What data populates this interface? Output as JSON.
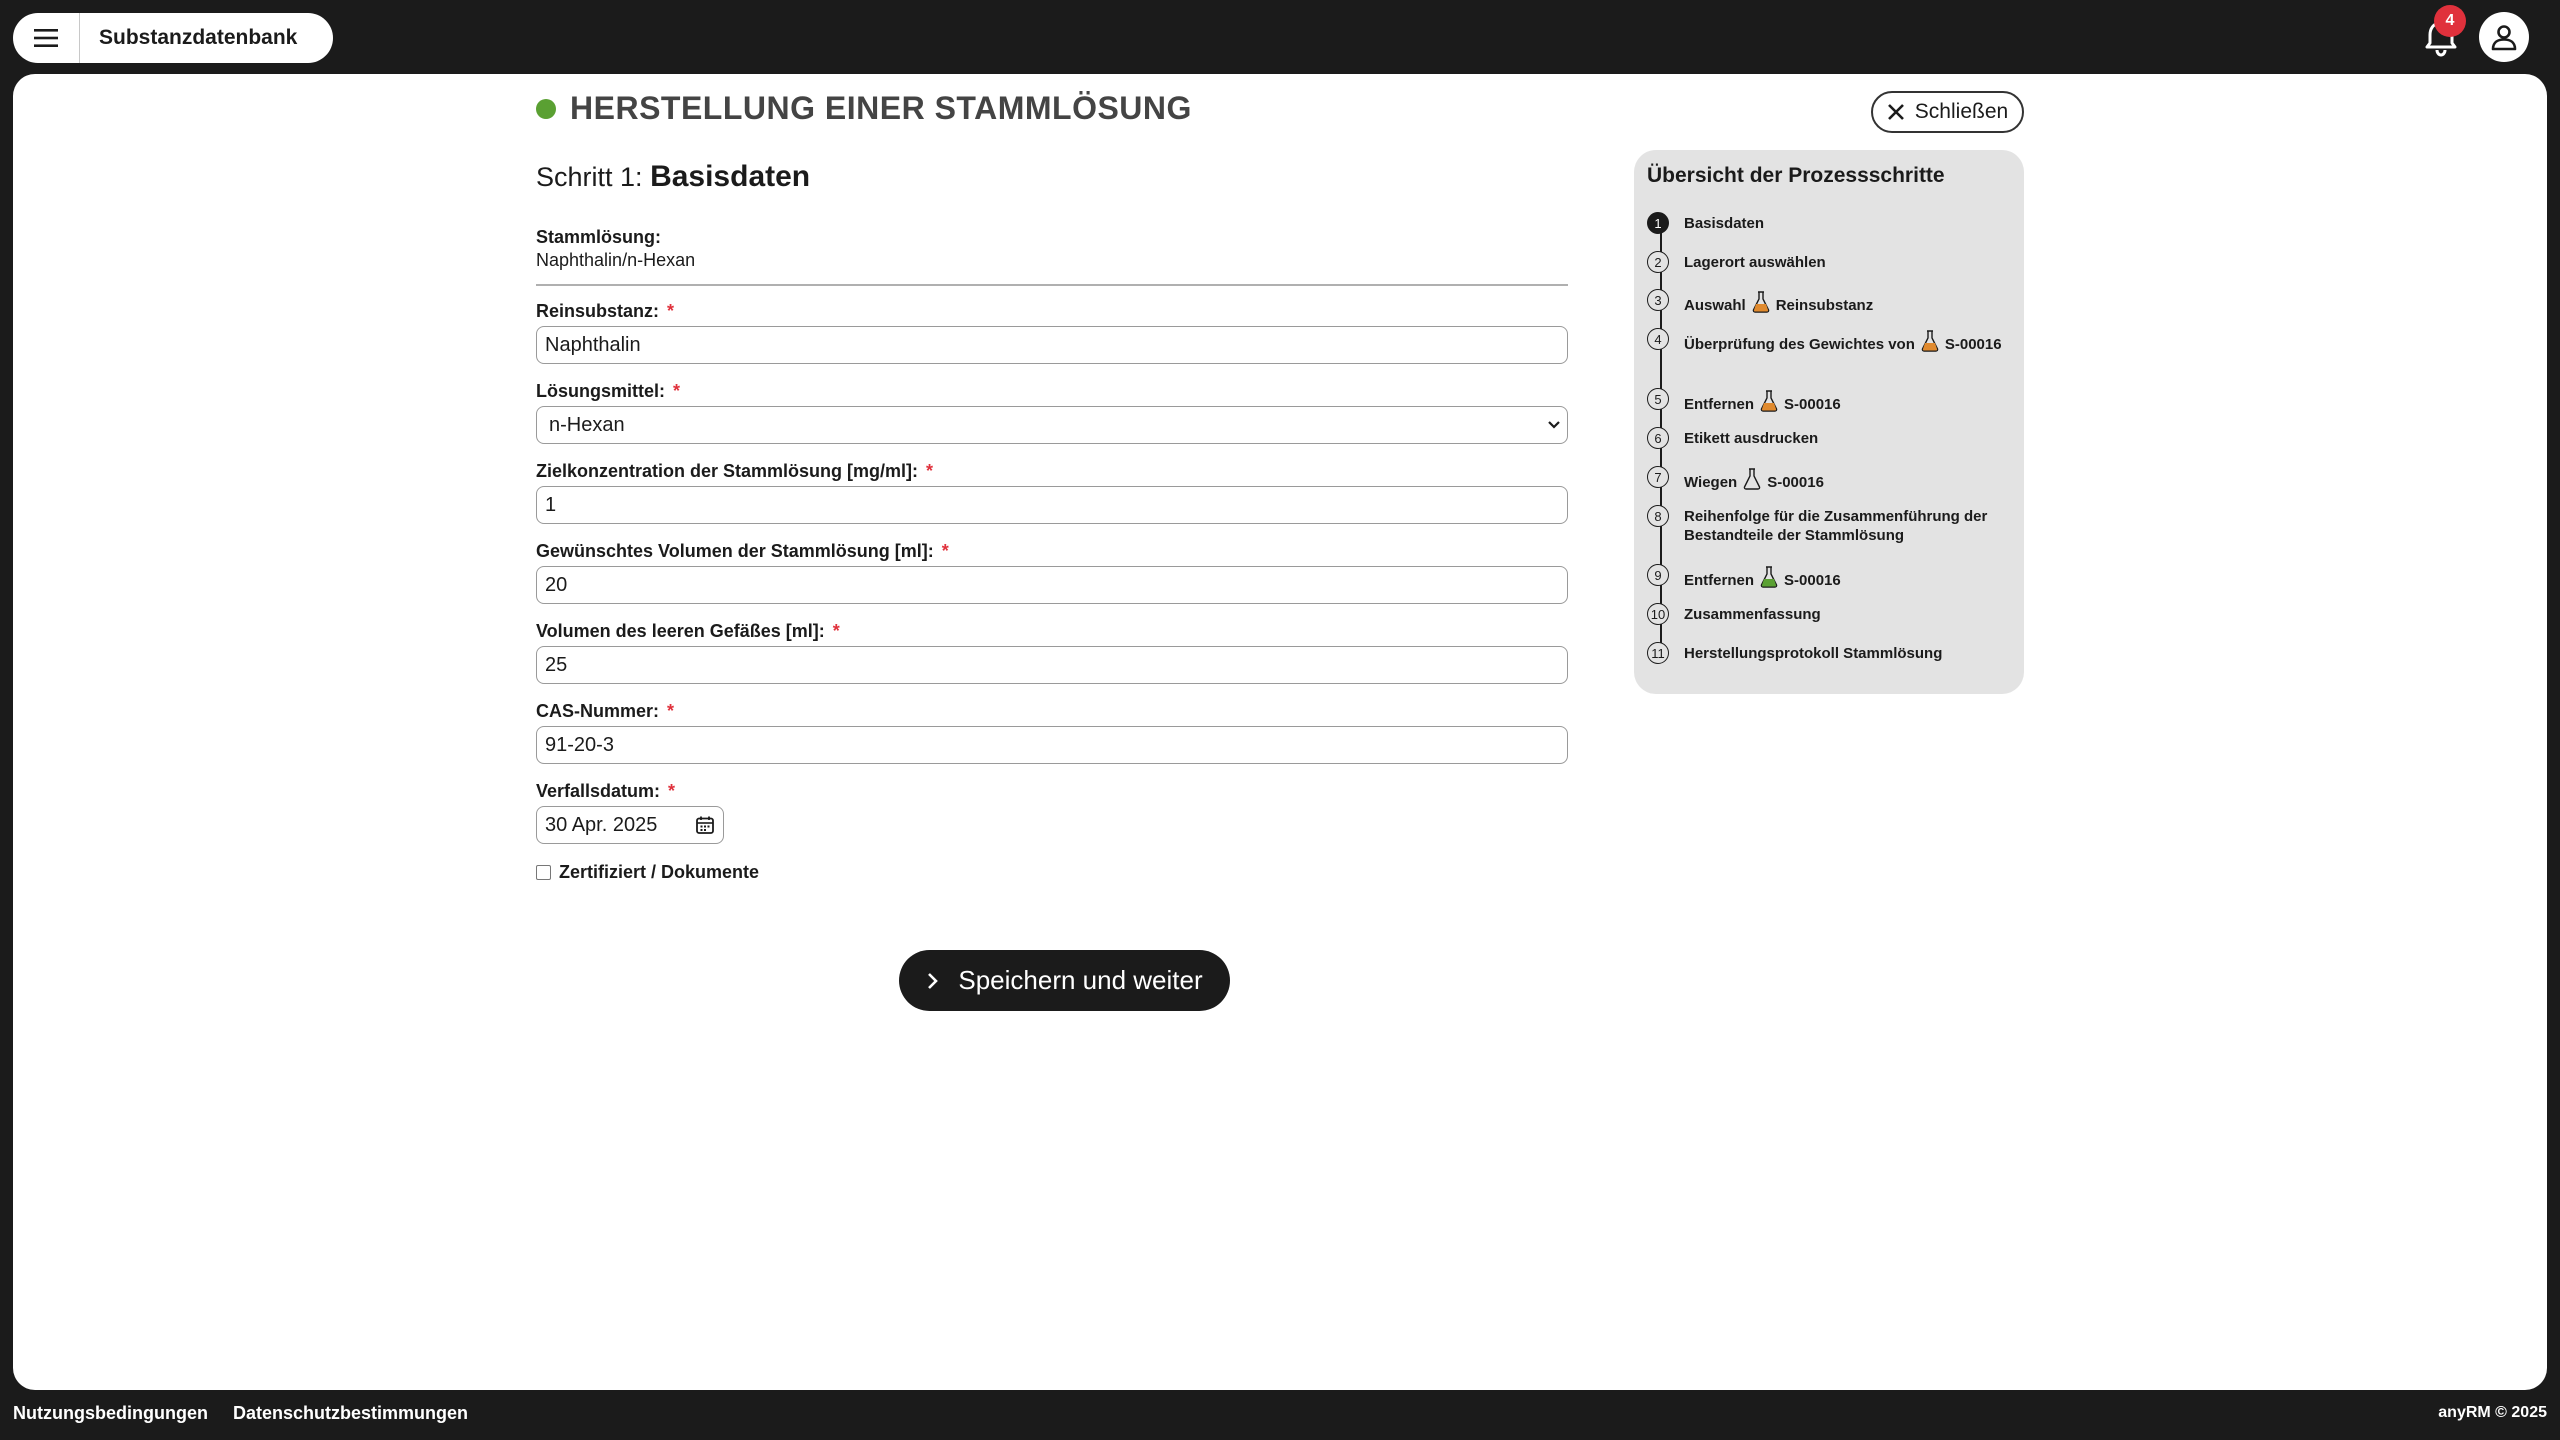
{
  "app": {
    "title": "Substanzdatenbank",
    "notification_count": "4"
  },
  "page": {
    "title": "HERSTELLUNG EINER STAMMLÖSUNG",
    "close_label": "Schließen",
    "step_prefix": "Schritt 1:",
    "step_name": "Basisdaten",
    "status_color": "#5aa032"
  },
  "form": {
    "stock_label": "Stammlösung:",
    "stock_value": "Naphthalin/n-Hexan",
    "substance_label": "Reinsubstanz:",
    "substance_value": "Naphthalin",
    "solvent_label": "Lösungsmittel:",
    "solvent_value": "n-Hexan",
    "concentration_label": "Zielkonzentration der Stammlösung [mg/ml]:",
    "concentration_value": "1",
    "volume_label": "Gewünschtes Volumen der Stammlösung [ml]:",
    "volume_value": "20",
    "empty_volume_label": "Volumen des leeren Gefäßes [ml]:",
    "empty_volume_value": "25",
    "cas_label": "CAS-Nummer:",
    "cas_value": "91-20-3",
    "expiry_label": "Verfallsdatum:",
    "expiry_value": "30 Apr. 2025",
    "certified_label": "Zertifiziert / Dokumente",
    "required_marker": "*",
    "save_label": "Speichern und weiter"
  },
  "sidebar": {
    "title": "Übersicht der Prozessschritte",
    "steps": [
      {
        "num": "1",
        "text": "Basisdaten",
        "active": true
      },
      {
        "num": "2",
        "text": "Lagerort auswählen"
      },
      {
        "num": "3",
        "before": "Auswahl",
        "icon": "flask-orange-icon",
        "after": "Reinsubstanz"
      },
      {
        "num": "4",
        "before": "Überprüfung des Gewichtes von",
        "icon": "flask-orange-icon",
        "after": "S-00016"
      },
      {
        "num": "5",
        "before": "Entfernen",
        "icon": "flask-orange-icon",
        "after": "S-00016"
      },
      {
        "num": "6",
        "text": "Etikett ausdrucken"
      },
      {
        "num": "7",
        "before": "Wiegen",
        "icon": "flask-outline-icon",
        "after": "S-00016"
      },
      {
        "num": "8",
        "text": "Reihenfolge für die Zusammenführung der Bestandteile der Stammlösung"
      },
      {
        "num": "9",
        "before": "Entfernen",
        "icon": "flask-green-icon",
        "after": "S-00016"
      },
      {
        "num": "10",
        "text": "Zusammenfassung"
      },
      {
        "num": "11",
        "text": "Herstellungsprotokoll Stammlösung"
      }
    ]
  },
  "footer": {
    "terms": "Nutzungsbedingungen",
    "privacy": "Datenschutzbestimmungen",
    "copyright": "anyRM © 2025"
  },
  "colors": {
    "orange": "#e08a2e",
    "green": "#5aa032",
    "badge": "#e0313c"
  }
}
